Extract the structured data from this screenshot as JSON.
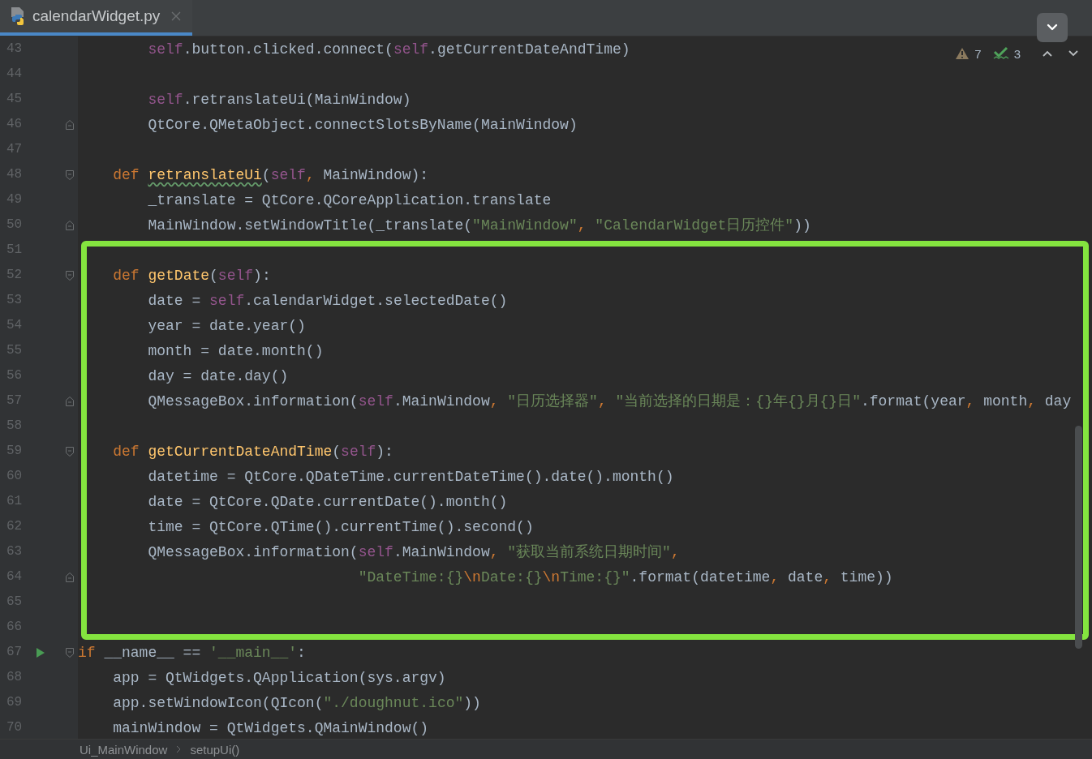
{
  "tabs": [
    {
      "label": "calendarWidget.py",
      "selected": true
    }
  ],
  "inspections": {
    "warnings": "7",
    "typos": "3"
  },
  "code_blocks": [
    {
      "highlighted": false,
      "lines": [
        {
          "number": "43",
          "kind": "plain",
          "segs": [
            {
              "kind": "self",
              "t": "        self"
            },
            {
              "kind": "plain",
              "t": ".button.clicked.connect("
            },
            {
              "kind": "self",
              "t": "self"
            },
            {
              "kind": "plain",
              "t": ".getCurrentDateAndTime)"
            }
          ]
        },
        {
          "number": "44",
          "kind": "plain"
        },
        {
          "number": "45",
          "kind": "plain",
          "segs": [
            {
              "kind": "self",
              "t": "        self"
            },
            {
              "kind": "plain",
              "t": ".retranslateUi(MainWindow)"
            }
          ]
        },
        {
          "number": "46",
          "kind": "fold_end",
          "segs": [
            {
              "kind": "plain",
              "t": "        QtCore.QMetaObject.connectSlotsByName(MainWindow)"
            }
          ]
        },
        {
          "number": "47",
          "kind": "plain"
        },
        {
          "number": "48",
          "kind": "fold_start",
          "segs": [
            {
              "kind": "kw",
              "t": "    def "
            },
            {
              "kind": "fn_typo",
              "t": "retranslateUi"
            },
            {
              "kind": "plain",
              "t": "("
            },
            {
              "kind": "self",
              "t": "self"
            },
            {
              "kind": "punct",
              "t": ", "
            },
            {
              "kind": "plain",
              "t": "MainWindow):"
            }
          ]
        },
        {
          "number": "49",
          "kind": "plain",
          "segs": [
            {
              "kind": "plain",
              "t": "        _translate = QtCore.QCoreApplication.translate"
            }
          ]
        },
        {
          "number": "50",
          "kind": "fold_end",
          "segs": [
            {
              "kind": "plain",
              "t": "        MainWindow.setWindowTitle(_translate("
            },
            {
              "kind": "str",
              "t": "\"MainWindow\""
            },
            {
              "kind": "punct",
              "t": ", "
            },
            {
              "kind": "str",
              "t": "\"CalendarWidget日历控件\""
            },
            {
              "kind": "plain",
              "t": "))"
            }
          ]
        }
      ]
    },
    {
      "highlighted": true,
      "lines": [
        {
          "number": "51",
          "kind": "plain"
        },
        {
          "number": "52",
          "kind": "fold_start",
          "segs": [
            {
              "kind": "kw",
              "t": "    def "
            },
            {
              "kind": "fn",
              "t": "getDate"
            },
            {
              "kind": "plain",
              "t": "("
            },
            {
              "kind": "self",
              "t": "self"
            },
            {
              "kind": "plain",
              "t": "):"
            }
          ]
        },
        {
          "number": "53",
          "kind": "plain",
          "segs": [
            {
              "kind": "plain",
              "t": "        date = "
            },
            {
              "kind": "self",
              "t": "self"
            },
            {
              "kind": "plain",
              "t": ".calendarWidget.selectedDate()"
            }
          ]
        },
        {
          "number": "54",
          "kind": "plain",
          "segs": [
            {
              "kind": "plain",
              "t": "        year = date.year()"
            }
          ]
        },
        {
          "number": "55",
          "kind": "plain",
          "segs": [
            {
              "kind": "plain",
              "t": "        month = date.month()"
            }
          ]
        },
        {
          "number": "56",
          "kind": "plain",
          "segs": [
            {
              "kind": "plain",
              "t": "        day = date.day()"
            }
          ]
        },
        {
          "number": "57",
          "kind": "fold_end",
          "segs": [
            {
              "kind": "plain",
              "t": "        QMessageBox.information("
            },
            {
              "kind": "self",
              "t": "self"
            },
            {
              "kind": "plain",
              "t": ".MainWindow"
            },
            {
              "kind": "punct",
              "t": ", "
            },
            {
              "kind": "str",
              "t": "\"日历选择器\""
            },
            {
              "kind": "punct",
              "t": ", "
            },
            {
              "kind": "str",
              "t": "\"当前选择的日期是：{}年{}月{}日\""
            },
            {
              "kind": "plain",
              "t": ".format(year"
            },
            {
              "kind": "punct",
              "t": ", "
            },
            {
              "kind": "plain",
              "t": "month"
            },
            {
              "kind": "punct",
              "t": ", "
            },
            {
              "kind": "plain",
              "t": "day"
            }
          ]
        },
        {
          "number": "58",
          "kind": "plain"
        },
        {
          "number": "59",
          "kind": "fold_start",
          "segs": [
            {
              "kind": "kw",
              "t": "    def "
            },
            {
              "kind": "fn",
              "t": "getCurrentDateAndTime"
            },
            {
              "kind": "plain",
              "t": "("
            },
            {
              "kind": "self",
              "t": "self"
            },
            {
              "kind": "plain",
              "t": "):"
            }
          ]
        },
        {
          "number": "60",
          "kind": "plain",
          "segs": [
            {
              "kind": "plain",
              "t": "        datetime = QtCore.QDateTime.currentDateTime().date().month()"
            }
          ]
        },
        {
          "number": "61",
          "kind": "plain",
          "segs": [
            {
              "kind": "plain",
              "t": "        date = QtCore.QDate.currentDate().month()"
            }
          ]
        },
        {
          "number": "62",
          "kind": "plain",
          "segs": [
            {
              "kind": "plain",
              "t": "        time = QtCore.QTime().currentTime().second()"
            }
          ]
        },
        {
          "number": "63",
          "kind": "plain",
          "segs": [
            {
              "kind": "plain",
              "t": "        QMessageBox.information("
            },
            {
              "kind": "self",
              "t": "self"
            },
            {
              "kind": "plain",
              "t": ".MainWindow"
            },
            {
              "kind": "punct",
              "t": ", "
            },
            {
              "kind": "str",
              "t": "\"获取当前系统日期时间\""
            },
            {
              "kind": "punct",
              "t": ","
            }
          ]
        },
        {
          "number": "64",
          "kind": "fold_end",
          "segs": [
            {
              "kind": "str",
              "t": "                                \"DateTime:{}"
            },
            {
              "kind": "esc",
              "t": "\\n"
            },
            {
              "kind": "str",
              "t": "Date:{}"
            },
            {
              "kind": "esc",
              "t": "\\n"
            },
            {
              "kind": "str",
              "t": "Time:{}\""
            },
            {
              "kind": "plain",
              "t": ".format(datetime"
            },
            {
              "kind": "punct",
              "t": ", "
            },
            {
              "kind": "plain",
              "t": "date"
            },
            {
              "kind": "punct",
              "t": ", "
            },
            {
              "kind": "plain",
              "t": "time))"
            }
          ]
        },
        {
          "number": "65",
          "kind": "plain"
        },
        {
          "number": "66",
          "kind": "plain"
        }
      ]
    },
    {
      "highlighted": false,
      "lines": [
        {
          "number": "67",
          "kind": "main_start",
          "segs": [
            {
              "kind": "kw",
              "t": "if "
            },
            {
              "kind": "plain",
              "t": "__name__ == "
            },
            {
              "kind": "str",
              "t": "'__main__'"
            },
            {
              "kind": "plain",
              "t": ":"
            }
          ]
        },
        {
          "number": "68",
          "kind": "plain",
          "segs": [
            {
              "kind": "plain",
              "t": "    app = QtWidgets.QApplication(sys.argv)"
            }
          ]
        },
        {
          "number": "69",
          "kind": "plain",
          "segs": [
            {
              "kind": "plain",
              "t": "    app.setWindowIcon(QIcon("
            },
            {
              "kind": "str",
              "t": "\"./doughnut.ico\""
            },
            {
              "kind": "plain",
              "t": "))"
            }
          ]
        },
        {
          "number": "70",
          "kind": "plain",
          "segs": [
            {
              "kind": "plain",
              "t": "    mainWindow = QtWidgets.QMainWindow()"
            }
          ]
        }
      ]
    }
  ],
  "breadcrumb": [
    "Ui_MainWindow",
    "setupUi()"
  ]
}
